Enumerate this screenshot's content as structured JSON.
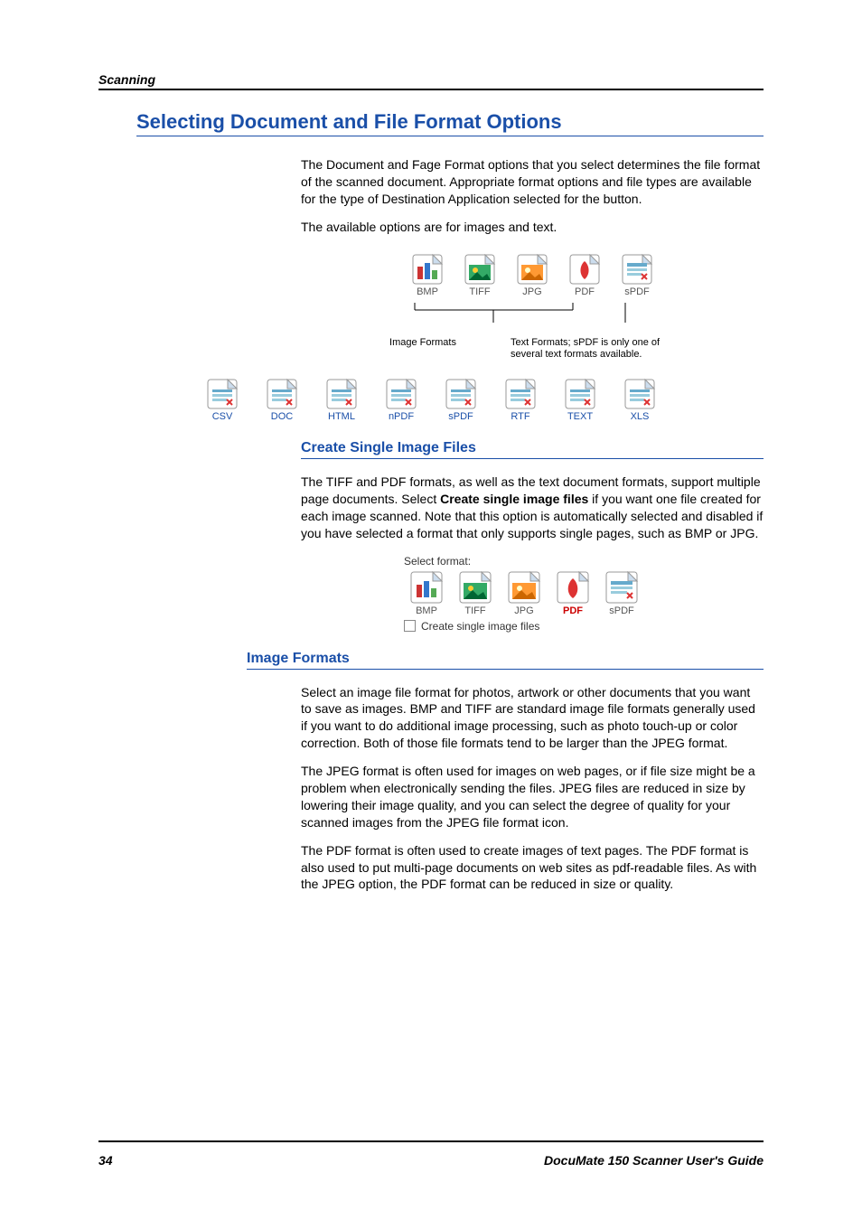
{
  "header": {
    "section": "Scanning"
  },
  "title": "Selecting Document and File Format Options",
  "intro1": "The Document and Fage Format options that you select determines the file format of the scanned document. Appropriate format options and file types are available for the type of Destination Application selected for the button.",
  "intro2": "The available options are for images and text.",
  "top_formats": [
    "BMP",
    "TIFF",
    "JPG",
    "PDF",
    "sPDF"
  ],
  "tree": {
    "left_label": "Image Formats",
    "right_label": "Text Formats; sPDF is only one of several text formats available."
  },
  "all_formats": [
    "CSV",
    "DOC",
    "HTML",
    "nPDF",
    "sPDF",
    "RTF",
    "TEXT",
    "XLS"
  ],
  "sub1": {
    "heading": "Create Single Image Files",
    "body_a": "The TIFF and PDF formats, as well as the text document formats, support multiple page documents. Select ",
    "body_bold": "Create single image files",
    "body_b": " if you want one file created for each image scanned. Note that this option is automatically selected and disabled if you have selected a format that only supports single pages, such as BMP or JPG."
  },
  "panel": {
    "title": "Select format:",
    "formats": [
      "BMP",
      "TIFF",
      "JPG",
      "PDF",
      "sPDF"
    ],
    "selected_index": 3,
    "checkbox_label": "Create single image files"
  },
  "sub2": {
    "heading": "Image Formats",
    "p1": "Select an image file format for photos, artwork or other documents that you want to save as images. BMP and TIFF are standard image file formats generally used if you want to do additional image processing, such as photo touch-up or color correction. Both of those file formats tend to be larger than the JPEG format.",
    "p2": "The JPEG format is often used for images on web pages, or if file size might be a problem when electronically sending the files. JPEG files are reduced in size by lowering their image quality, and you can select the degree of quality for your scanned images from the JPEG file format icon.",
    "p3": "The PDF format is often used to create images of text pages. The PDF format is also used to put multi-page documents on web sites as pdf-readable files. As with the JPEG option, the PDF format can be reduced in size or quality."
  },
  "footer": {
    "page": "34",
    "book": "DocuMate 150 Scanner User's Guide"
  }
}
